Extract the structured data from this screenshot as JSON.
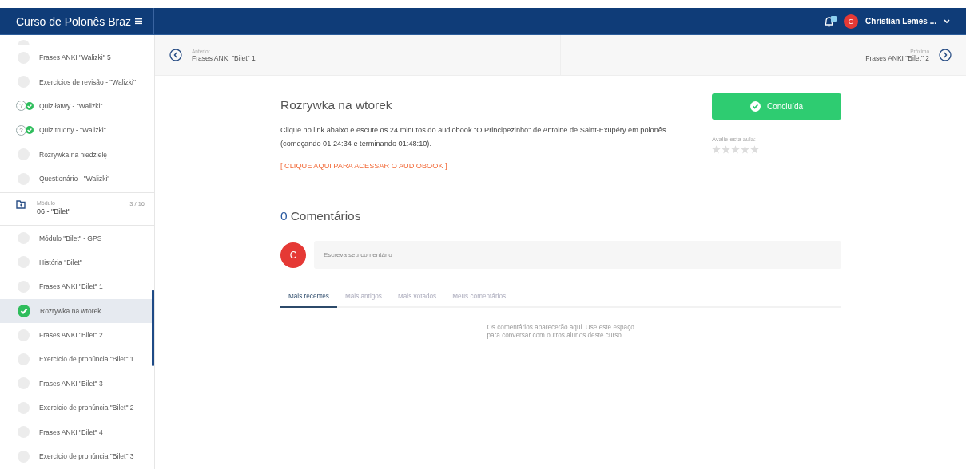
{
  "header": {
    "course_title": "Curso de Polonês Braz",
    "user_initial": "C",
    "user_name": "Christian Lemes ..."
  },
  "sidebar": {
    "items": [
      {
        "kind": "lesson",
        "title": "Frases ANKI \"Walizki\" 5",
        "completed": false,
        "selected": false
      },
      {
        "kind": "lesson",
        "title": "Exercícios de revisão - \"Walizki\"",
        "completed": false,
        "selected": false
      },
      {
        "kind": "quiz",
        "badge": "?",
        "title": "Quiz łatwy - \"Walizki\"",
        "completed": true,
        "selected": false
      },
      {
        "kind": "quiz",
        "badge": "?",
        "title": "Quiz trudny - \"Walizki\"",
        "completed": true,
        "selected": false
      },
      {
        "kind": "lesson",
        "title": "Rozrywka na niedzielę",
        "completed": false,
        "selected": false
      },
      {
        "kind": "lesson",
        "title": "Questionário - \"Walizki\"",
        "completed": false,
        "selected": false
      },
      {
        "kind": "module",
        "label": "Módulo",
        "title": "06 - \"Bilet\"",
        "count": "3 / 16"
      },
      {
        "kind": "lesson",
        "title": "Módulo \"Bilet\" - GPS",
        "completed": false,
        "selected": false
      },
      {
        "kind": "lesson",
        "title": "História \"Bilet\"",
        "completed": false,
        "selected": false
      },
      {
        "kind": "lesson",
        "title": "Frases ANKI \"Bilet\" 1",
        "completed": false,
        "selected": false
      },
      {
        "kind": "lesson",
        "title": "Rozrywka na wtorek",
        "completed": true,
        "selected": true
      },
      {
        "kind": "lesson",
        "title": "Frases ANKI \"Bilet\" 2",
        "completed": false,
        "selected": false
      },
      {
        "kind": "lesson",
        "title": "Exercício de pronúncia \"Bilet\" 1",
        "completed": false,
        "selected": false
      },
      {
        "kind": "lesson",
        "title": "Frases ANKI \"Bilet\" 3",
        "completed": false,
        "selected": false
      },
      {
        "kind": "lesson",
        "title": "Exercício de pronúncia \"Bilet\" 2",
        "completed": false,
        "selected": false
      },
      {
        "kind": "lesson",
        "title": "Frases ANKI \"Bilet\" 4",
        "completed": false,
        "selected": false
      },
      {
        "kind": "lesson",
        "title": "Exercício de pronúncia \"Bilet\" 3",
        "completed": false,
        "selected": false
      }
    ]
  },
  "navigation": {
    "previous": {
      "label": "Anterior",
      "title": "Frases ANKI \"Bilet\" 1"
    },
    "next": {
      "label": "Próximo",
      "title": "Frases ANKI \"Bilet\" 2"
    }
  },
  "lesson": {
    "title": "Rozrywka na wtorek",
    "description": "Clique no link abaixo e escute os 24 minutos do audiobook \"O Principezinho\" de Antoine de Saint-Exupéry em polonês (começando 01:24:34 e terminando 01:48:10).",
    "link": "[ CLIQUE AQUI PARA ACESSAR O AUDIOBOOK ]",
    "complete_button": "Concluída",
    "rating_label": "Avalie esta aula:",
    "stars": 0
  },
  "comments": {
    "count": "0",
    "heading": "Comentários",
    "avatar_initial": "C",
    "placeholder": "Escreva seu comentário",
    "tabs": [
      {
        "label": "Mais recentes",
        "selected": true
      },
      {
        "label": "Mais antigos",
        "selected": false
      },
      {
        "label": "Mais votados",
        "selected": false
      },
      {
        "label": "Meus comentários",
        "selected": false
      }
    ],
    "empty_message": "Os comentários aparecerão aqui. Use este espaço para conversar com outros alunos deste curso."
  }
}
